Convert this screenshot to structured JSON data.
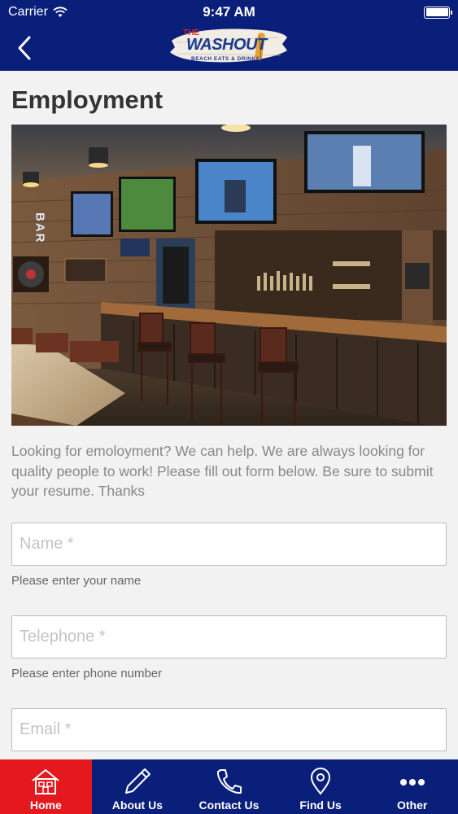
{
  "status_bar": {
    "carrier": "Carrier",
    "time": "9:47 AM",
    "battery_level": 1.0
  },
  "header": {
    "logo": {
      "line1": "THE",
      "line2": "WASHOUT",
      "line3": "BEACH EATS & DRINKS"
    },
    "icons": {
      "back": "chevron-left-icon"
    }
  },
  "page": {
    "title": "Employment",
    "intro": "Looking for emoloyment?  We can help.  We are always looking for quality people to work!  Please fill out form below.  Be sure to submit your resume.  Thanks"
  },
  "photo_signs": {
    "bar": "BAR"
  },
  "form": {
    "name": {
      "placeholder": "Name *",
      "value": "",
      "hint": "Please enter your name"
    },
    "telephone": {
      "placeholder": "Telephone *",
      "value": "",
      "hint": "Please enter phone number"
    },
    "email": {
      "placeholder": "Email *",
      "value": ""
    }
  },
  "tabbar": {
    "tabs": [
      {
        "label": "Home",
        "icon": "home-icon",
        "active": true
      },
      {
        "label": "About Us",
        "icon": "pencil-icon",
        "active": false
      },
      {
        "label": "Contact Us",
        "icon": "phone-icon",
        "active": false
      },
      {
        "label": "Find Us",
        "icon": "map-pin-icon",
        "active": false
      },
      {
        "label": "Other",
        "icon": "more-dots-icon",
        "active": false
      }
    ]
  },
  "colors": {
    "nav_background": "#0a1f7a",
    "active_tab": "#e3191e",
    "page_background": "#f2f2f2"
  }
}
